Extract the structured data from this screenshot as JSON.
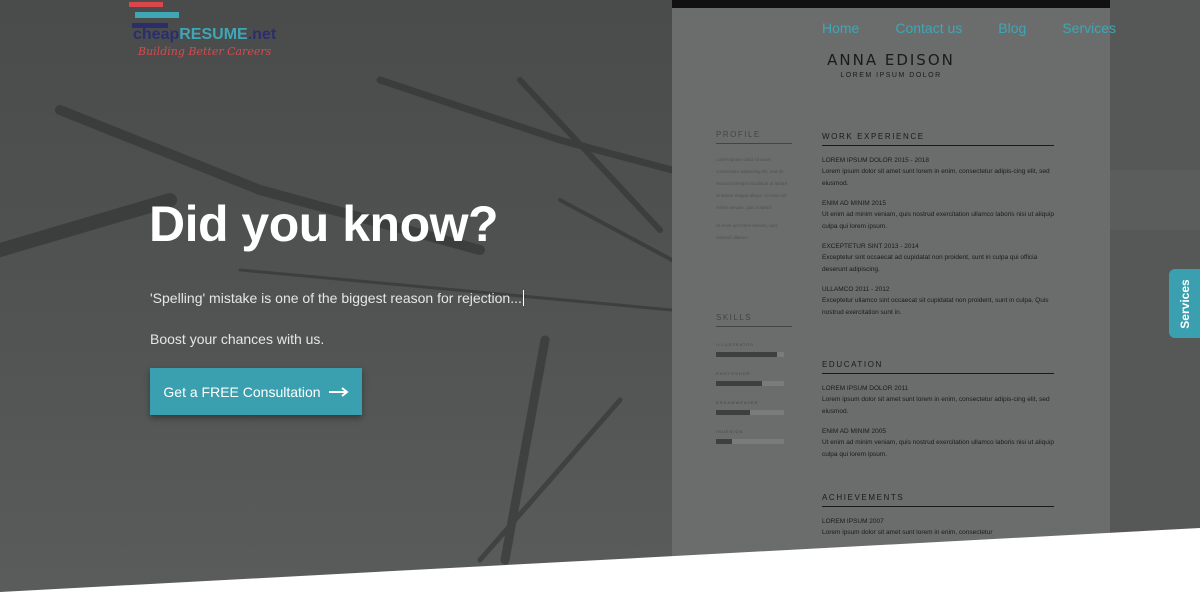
{
  "logo": {
    "word_part1": "cheap",
    "word_part2": "RESUME",
    "word_part3": ".net",
    "tagline": "Building Better Careers"
  },
  "nav": {
    "items": [
      {
        "label": "Home"
      },
      {
        "label": "Contact us"
      },
      {
        "label": "Blog"
      },
      {
        "label": "Services"
      }
    ]
  },
  "hero": {
    "title": "Did you know?",
    "fact": "'Spelling' mistake is one of the biggest reason for rejection...",
    "boost": "Boost your chances with us.",
    "cta_label": "Get a FREE Consultation"
  },
  "side_tab": {
    "label": "Services"
  },
  "resume": {
    "name": "ANNA EDISON",
    "role": "LOREM IPSUM DOLOR",
    "profile_header": "PROFILE",
    "profile_text": "Lorem ipsum dolor sit amet, consectetur adipiscing elit, sed do eiusmod tempor incididunt ut labore et dolore magna aliqua. Ut enim ad minim veniam, quis nostrud",
    "profile_text2": "Ut enim ad minim veniam, quis nostrud ullamco",
    "skills_header": "SKILLS",
    "skills": [
      {
        "label": "ILLUSTRATOR",
        "level": 0.9
      },
      {
        "label": "PHOTOSHOP",
        "level": 0.68
      },
      {
        "label": "DREAMWEAVER",
        "level": 0.5
      },
      {
        "label": "INDESIGN",
        "level": 0.24
      }
    ],
    "work_header": "WORK EXPERIENCE",
    "work": [
      {
        "title": "LOREM IPSUM DOLOR  2015 - 2018",
        "desc": "Lorem ipsum dolor sit amet sunt lorem in enim, consectetur adipis-cing elit, sed eiusmod."
      },
      {
        "title": "ENIM AD MINIM  2015",
        "desc": "Ut enim ad minim veniam, quis nostrud exercitation ullamco laboris nisi ut aliquip culpa qui lorem ipsum."
      },
      {
        "title": "EXCEPTETUR SINT  2013 - 2014",
        "desc": "Exceptetur sint occaecat ad cupidatat non proident, sunt in culpa qui officia deserunt adipiscing."
      },
      {
        "title": "ULLAMCO  2011 - 2012",
        "desc": "Exceptetur ullamco sint occaecat sit cupidatat non proident, sunt in culpa. Quis nostrud exercitation sunt in."
      }
    ],
    "education_header": "EDUCATION",
    "education": [
      {
        "title": "LOREM IPSUM DOLOR  2011",
        "desc": "Lorem ipsum dolor sit amet sunt lorem in enim, consectetur adipis-cing elit, sed eiusmod."
      },
      {
        "title": "ENIM AD MINIM  2005",
        "desc": "Ut enim ad minim veniam, quis nostrud exercitation ullamco laboris nisi ut aliquip culpa qui lorem ipsum."
      }
    ],
    "achievements_header": "ACHIEVEMENTS",
    "achievements": [
      {
        "title": "LOREM IPSUM  2007",
        "desc": "Lorem ipsum dolor sit amet sunt lorem in enim, consectetur"
      }
    ]
  },
  "colors": {
    "accent": "#3a9fae",
    "brand_red": "#d9474c",
    "brand_navy": "#2b2e6b"
  }
}
